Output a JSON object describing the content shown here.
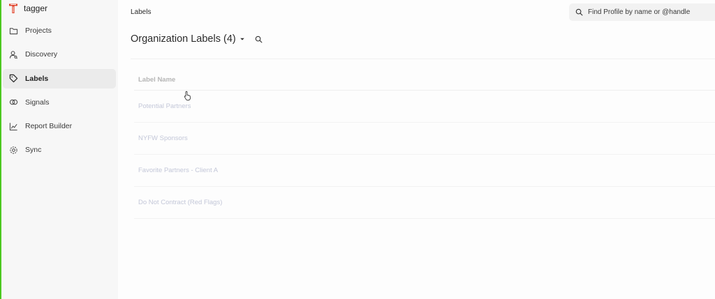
{
  "brand": {
    "name": "tagger",
    "logo_icon": "tagger-logo-icon",
    "accent_color": "#e0442c"
  },
  "sidebar": {
    "items": [
      {
        "label": "Projects",
        "icon": "folder-icon",
        "active": false
      },
      {
        "label": "Discovery",
        "icon": "user-search-icon",
        "active": false
      },
      {
        "label": "Labels",
        "icon": "tag-icon",
        "active": true
      },
      {
        "label": "Signals",
        "icon": "signals-icon",
        "active": false
      },
      {
        "label": "Report Builder",
        "icon": "line-chart-icon",
        "active": false
      },
      {
        "label": "Sync",
        "icon": "sync-icon",
        "active": false
      }
    ]
  },
  "header": {
    "breadcrumb": "Labels",
    "search": {
      "placeholder": "Find Profile by name or @handle",
      "value": "",
      "icon": "search-icon"
    }
  },
  "main": {
    "title": "Organization Labels (4)",
    "table": {
      "column_header": "Label Name",
      "rows": [
        "Potential Partners",
        "NYFW Sponsors",
        "Favorite Partners - Client A",
        "Do Not Contract (Red Flags)"
      ]
    }
  },
  "colors": {
    "frame_border": "#4cc81f",
    "row_text": "#c3c7d8",
    "sidebar_bg": "#f7f7f7"
  }
}
